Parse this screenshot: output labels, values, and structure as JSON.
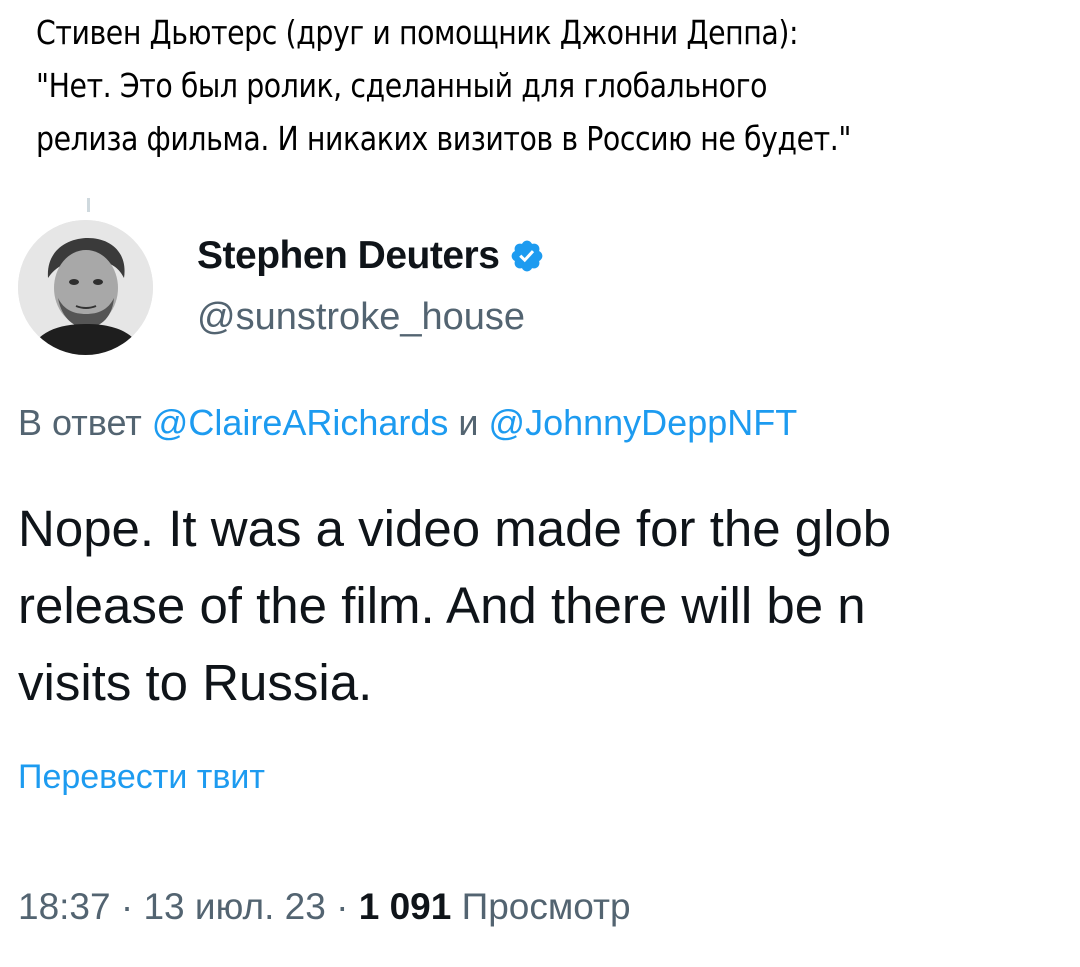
{
  "caption": {
    "line1": "Стивен Дьютерс (друг и помощник Джонни Деппа):",
    "line2": "\"Нет. Это был ролик, сделанный для глобального",
    "line3": "релиза фильма. И никаких визитов в Россию не будет.\""
  },
  "tweet": {
    "display_name": "Stephen Deuters",
    "handle": "@sunstroke_house",
    "verified_icon": "verified-badge-icon",
    "reply_prefix": "В ответ ",
    "reply_mention_1": "@ClaireARichards",
    "reply_joiner": " и ",
    "reply_mention_2": "@JohnnyDeppNFT",
    "body_line1": "Nope. It was a video made for the glob",
    "body_line2": "release of the film. And there will be n",
    "body_line3": "visits to Russia.",
    "translate_label": "Перевести твит",
    "time": "18:37",
    "sep1": " · ",
    "date": "13 июл. 23",
    "sep2": " · ",
    "views_count": "1 091",
    "views_label": " Просмотр"
  },
  "colors": {
    "accent": "#1d9bf0",
    "secondary_text": "#536471",
    "primary_text": "#0f1419"
  }
}
